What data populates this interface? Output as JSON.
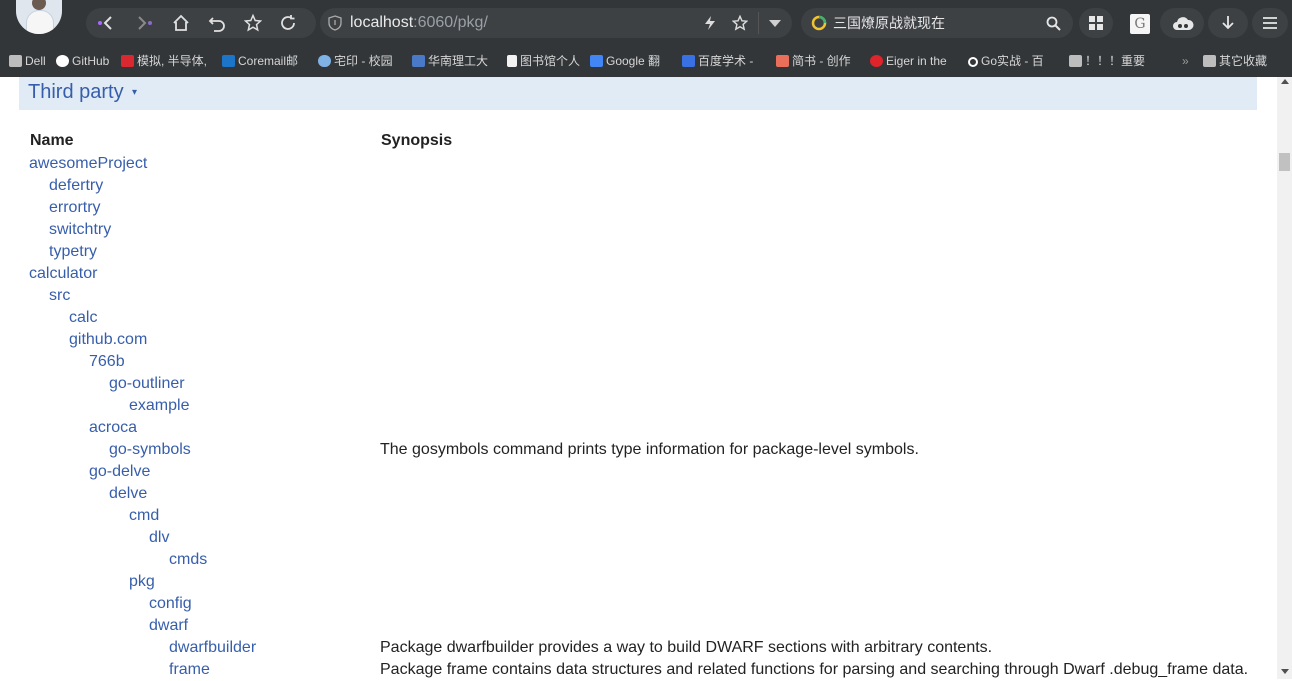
{
  "browser": {
    "url_host": "localhost",
    "url_rest": ":6060/pkg/",
    "search_text": "三国燎原战就现在"
  },
  "bookmarks": [
    {
      "label": "Dell",
      "icon": "folder-icon",
      "color": "#bdbdbd"
    },
    {
      "label": "GitHub",
      "icon": "github-icon",
      "color": "#ffffff"
    },
    {
      "label": "模拟, 半导体,",
      "icon": "ti-icon",
      "color": "#d9282f"
    },
    {
      "label": "Coremail邮",
      "icon": "coremail-icon",
      "color": "#1d75c9"
    },
    {
      "label": "宅印 - 校园",
      "icon": "cloud-icon",
      "color": "#7fb2e5"
    },
    {
      "label": "华南理工大",
      "icon": "scut-icon",
      "color": "#4a79c7"
    },
    {
      "label": "图书馆个人",
      "icon": "page-icon",
      "color": "#f2f2f2"
    },
    {
      "label": "Google 翻",
      "icon": "translate-icon",
      "color": "#4285f4"
    },
    {
      "label": "百度学术 -",
      "icon": "baidu-icon",
      "color": "#3970e3"
    },
    {
      "label": "简书 - 创作",
      "icon": "jianshu-icon",
      "color": "#ea6f5a"
    },
    {
      "label": "Eiger in the",
      "icon": "eiger-icon",
      "color": "#e0242b"
    },
    {
      "label": "Go实战 - 百",
      "icon": "glasses-icon",
      "color": "#ffffff"
    },
    {
      "label": "！！！重要",
      "icon": "folder-icon",
      "color": "#bdbdbd"
    },
    {
      "label": "»",
      "icon": "",
      "color": ""
    },
    {
      "label": "其它收藏",
      "icon": "folder-icon",
      "color": "#bdbdbd"
    }
  ],
  "section": {
    "title": "Third party",
    "toggle": "▾"
  },
  "table": {
    "headers": {
      "name": "Name",
      "synopsis": "Synopsis"
    },
    "rows": [
      {
        "name": "awesomeProject",
        "depth": 0,
        "synopsis": ""
      },
      {
        "name": "defertry",
        "depth": 1,
        "synopsis": ""
      },
      {
        "name": "errortry",
        "depth": 1,
        "synopsis": ""
      },
      {
        "name": "switchtry",
        "depth": 1,
        "synopsis": ""
      },
      {
        "name": "typetry",
        "depth": 1,
        "synopsis": ""
      },
      {
        "name": "calculator",
        "depth": 0,
        "synopsis": ""
      },
      {
        "name": "src",
        "depth": 1,
        "synopsis": ""
      },
      {
        "name": "calc",
        "depth": 2,
        "synopsis": ""
      },
      {
        "name": "github.com",
        "depth": 2,
        "synopsis": ""
      },
      {
        "name": "766b",
        "depth": 3,
        "synopsis": ""
      },
      {
        "name": "go-outliner",
        "depth": 4,
        "synopsis": ""
      },
      {
        "name": "example",
        "depth": 5,
        "synopsis": ""
      },
      {
        "name": "acroca",
        "depth": 3,
        "synopsis": ""
      },
      {
        "name": "go-symbols",
        "depth": 4,
        "synopsis": "The gosymbols command prints type information for package-level symbols."
      },
      {
        "name": "go-delve",
        "depth": 3,
        "synopsis": ""
      },
      {
        "name": "delve",
        "depth": 4,
        "synopsis": ""
      },
      {
        "name": "cmd",
        "depth": 5,
        "synopsis": ""
      },
      {
        "name": "dlv",
        "depth": 6,
        "synopsis": ""
      },
      {
        "name": "cmds",
        "depth": 7,
        "synopsis": ""
      },
      {
        "name": "pkg",
        "depth": 5,
        "synopsis": ""
      },
      {
        "name": "config",
        "depth": 6,
        "synopsis": ""
      },
      {
        "name": "dwarf",
        "depth": 6,
        "synopsis": ""
      },
      {
        "name": "dwarfbuilder",
        "depth": 7,
        "synopsis": "Package dwarfbuilder provides a way to build DWARF sections with arbitrary contents."
      },
      {
        "name": "frame",
        "depth": 7,
        "synopsis": "Package frame contains data structures and related functions for parsing and searching through Dwarf .debug_frame data."
      }
    ]
  }
}
